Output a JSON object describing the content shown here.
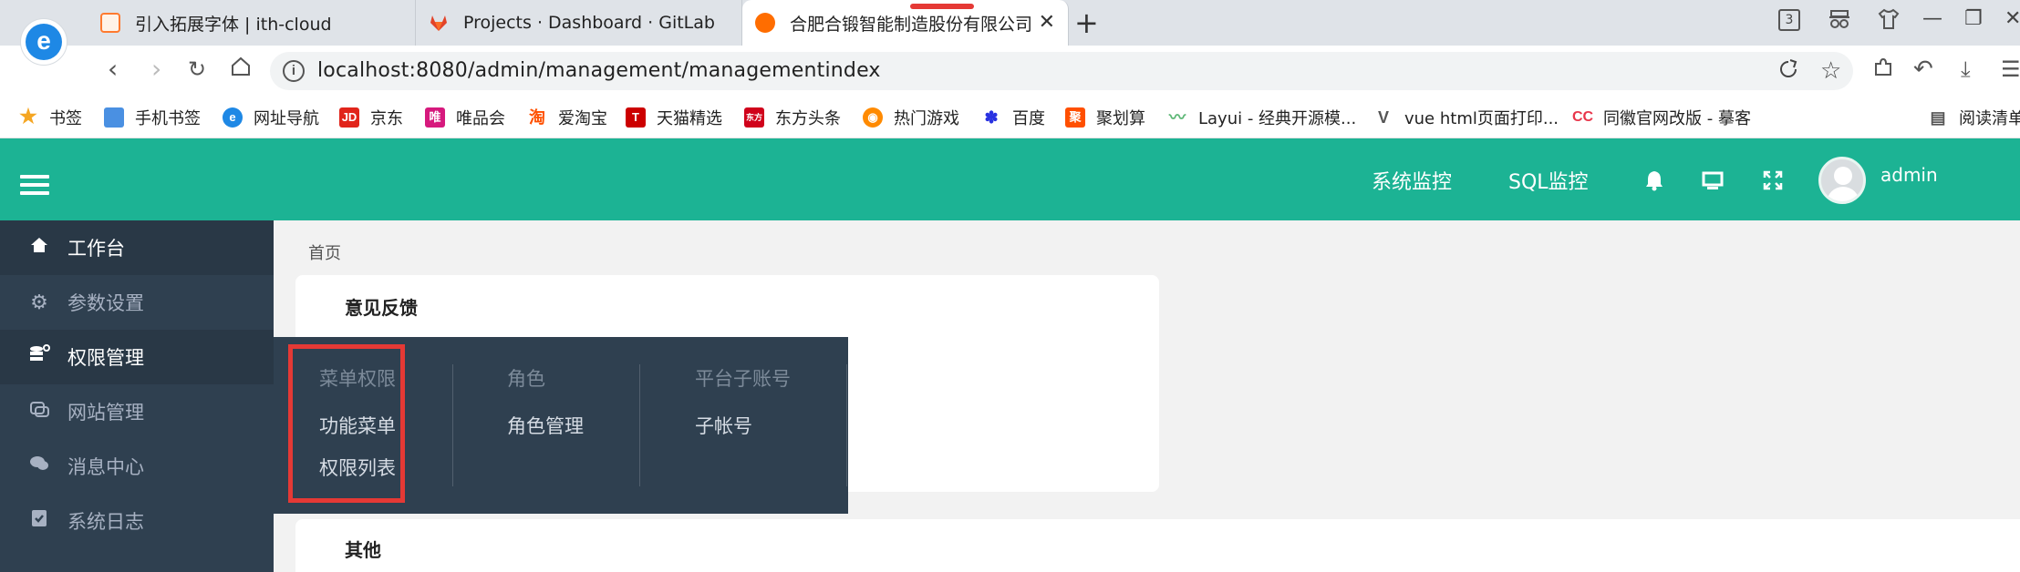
{
  "browser": {
    "tabs": [
      {
        "title": "引入拓展字体 | ith-cloud",
        "icon": "ith-cloud-favicon",
        "active": false
      },
      {
        "title": "Projects · Dashboard · GitLab",
        "icon": "gitlab-favicon",
        "active": false
      },
      {
        "title": "合肥合锻智能制造股份有限公司",
        "icon": "app-favicon",
        "active": true
      }
    ],
    "tab_count_badge": "3",
    "url": "localhost:8080/admin/management/managementindex",
    "bookmarks": [
      {
        "label": "书签",
        "icon": "star-icon",
        "color": "#f5a623"
      },
      {
        "label": "手机书签",
        "icon": "phone-bookmark-icon",
        "color": "#4a90e2"
      },
      {
        "label": "网址导航",
        "icon": "nav-icon",
        "color": "#1e88e5"
      },
      {
        "label": "京东",
        "icon": "jd-icon",
        "color": "#e1251b"
      },
      {
        "label": "唯品会",
        "icon": "vip-icon",
        "color": "#d6197d"
      },
      {
        "label": "爱淘宝",
        "icon": "taobao-icon",
        "color": "#ff5000"
      },
      {
        "label": "天猫精选",
        "icon": "tmall-icon",
        "color": "#cc0000"
      },
      {
        "label": "东方头条",
        "icon": "dftt-icon",
        "color": "#d0021b"
      },
      {
        "label": "热门游戏",
        "icon": "game-icon",
        "color": "#ff8a00"
      },
      {
        "label": "百度",
        "icon": "baidu-icon",
        "color": "#2932e1"
      },
      {
        "label": "聚划算",
        "icon": "juhuasuan-icon",
        "color": "#ff4f00"
      },
      {
        "label": "Layui - 经典开源模...",
        "icon": "layui-icon",
        "color": "#5fb878"
      },
      {
        "label": "vue html页面打印...",
        "icon": "vue-icon",
        "color": "#555555"
      },
      {
        "label": "同徽官网改版 - 摹客",
        "icon": "mockplus-icon",
        "color": "#e8364b"
      },
      {
        "label": "阅读清单",
        "icon": "reading-list-icon",
        "color": "#555555"
      }
    ]
  },
  "header": {
    "accent": "#1cb394",
    "links": [
      "系统监控",
      "SQL监控"
    ],
    "icons": [
      "bell-icon",
      "monitor-icon",
      "fullscreen-icon"
    ],
    "user": "admin"
  },
  "sidebar": {
    "items": [
      {
        "label": "工作台",
        "icon": "home-icon"
      },
      {
        "label": "参数设置",
        "icon": "gears-icon"
      },
      {
        "label": "权限管理",
        "icon": "permission-icon"
      },
      {
        "label": "网站管理",
        "icon": "website-icon"
      },
      {
        "label": "消息中心",
        "icon": "message-icon"
      },
      {
        "label": "系统日志",
        "icon": "log-icon"
      }
    ]
  },
  "content": {
    "breadcrumb": "首页",
    "card1_title": "意见反馈",
    "card2_title": "其他"
  },
  "flyout": {
    "columns": [
      {
        "heading": "菜单权限",
        "items": [
          "功能菜单",
          "权限列表"
        ]
      },
      {
        "heading": "角色",
        "items": [
          "角色管理"
        ]
      },
      {
        "heading": "平台子账号",
        "items": [
          "子帐号"
        ]
      }
    ]
  }
}
